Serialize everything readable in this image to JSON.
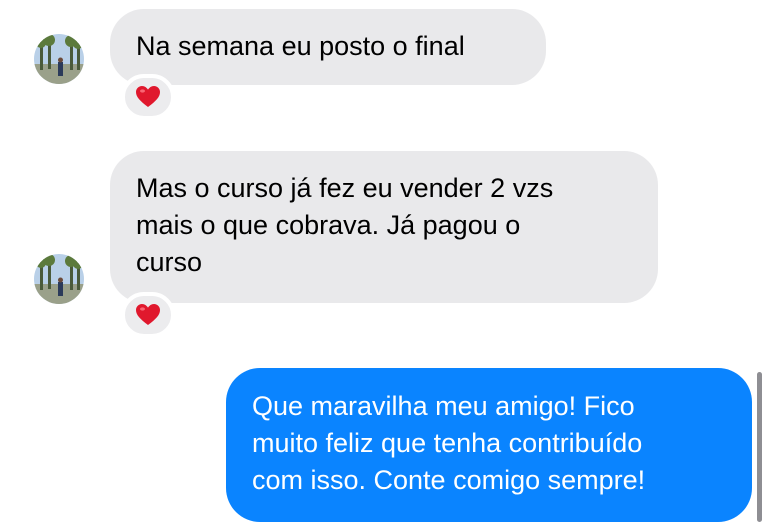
{
  "messages": [
    {
      "direction": "received",
      "text": "Na semana eu posto o final",
      "reaction": "heart"
    },
    {
      "direction": "received",
      "text": "Mas o curso já fez eu vender 2 vzs\nmais o que cobrava. Já pagou o\ncurso",
      "reaction": "heart"
    },
    {
      "direction": "sent",
      "text": "Que maravilha meu amigo! Fico\nmuito feliz que tenha contribuído\ncom isso. Conte comigo sempre!"
    }
  ],
  "icons": {
    "avatar": "contact-avatar-photo",
    "reaction": "red-heart-icon"
  },
  "colors": {
    "received_bubble": "#e9e9eb",
    "sent_bubble": "#0a84ff",
    "heart": "#e0182d"
  }
}
